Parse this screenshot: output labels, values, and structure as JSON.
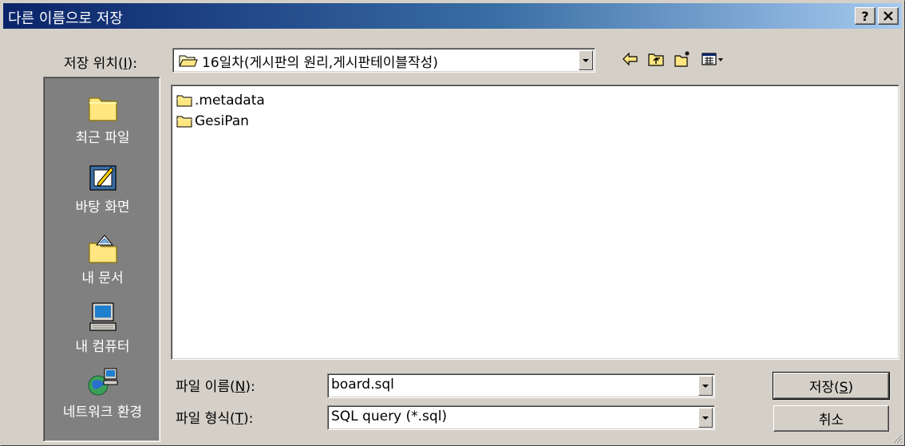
{
  "window": {
    "title": "다른 이름으로 저장",
    "help_button": "?",
    "close_button": "✕"
  },
  "location": {
    "label_prefix": "저장 위치(",
    "label_key": "I",
    "label_suffix": "):",
    "current_folder": "16일차(게시판의 원리,게시판테이블작성)"
  },
  "toolbar": {
    "back_icon": "back-arrow-icon",
    "up_icon": "up-folder-icon",
    "new_folder_icon": "new-folder-icon",
    "view_menu_icon": "view-menu-icon"
  },
  "places": [
    {
      "label": "최근 파일",
      "icon": "recent-files-icon"
    },
    {
      "label": "바탕 화면",
      "icon": "desktop-icon"
    },
    {
      "label": "내 문서",
      "icon": "my-documents-icon"
    },
    {
      "label": "내 컴퓨터",
      "icon": "my-computer-icon"
    },
    {
      "label": "네트워크 환경",
      "icon": "network-icon"
    }
  ],
  "files": [
    {
      "name": ".metadata",
      "type": "folder"
    },
    {
      "name": "GesiPan",
      "type": "folder"
    }
  ],
  "filename": {
    "label_prefix": "파일 이름(",
    "label_key": "N",
    "label_suffix": "):",
    "value": "board.sql"
  },
  "filetype": {
    "label_prefix": "파일 형식(",
    "label_key": "T",
    "label_suffix": "):",
    "value": "SQL query (*.sql)"
  },
  "buttons": {
    "save_prefix": "저장(",
    "save_key": "S",
    "save_suffix": ")",
    "cancel": "취소"
  }
}
